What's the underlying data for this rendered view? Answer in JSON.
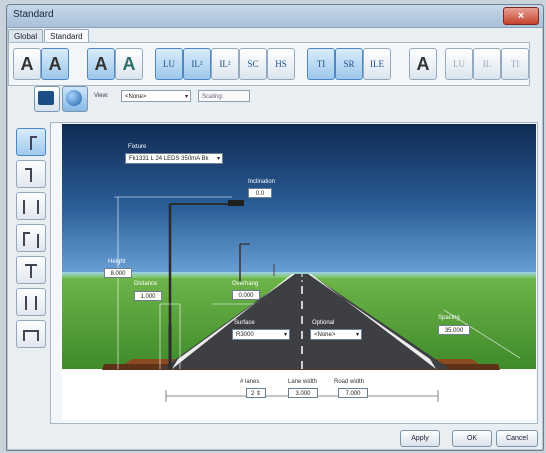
{
  "window": {
    "title": "Standard",
    "close_label": "×"
  },
  "tabs": [
    {
      "label": "Global"
    },
    {
      "label": "Standard"
    }
  ],
  "toolbar": [
    {
      "label": "A",
      "style": "bold"
    },
    {
      "label": "A",
      "style": "bold sel"
    },
    {
      "label": "A",
      "style": "bold sel"
    },
    {
      "label": "A",
      "style": "bold teal"
    },
    {
      "label": "LU",
      "style": "sel"
    },
    {
      "label": "IL²",
      "style": "sel"
    },
    {
      "label": "IL²",
      "style": ""
    },
    {
      "label": "SC",
      "style": ""
    },
    {
      "label": "HS",
      "style": ""
    },
    {
      "label": "TI",
      "style": "sel"
    },
    {
      "label": "SR",
      "style": "sel"
    },
    {
      "label": "ILE",
      "style": ""
    },
    {
      "label": "A",
      "style": "bold"
    },
    {
      "label": "LU",
      "style": "dim"
    },
    {
      "label": "IL",
      "style": "dim"
    },
    {
      "label": "TI",
      "style": "dim"
    }
  ],
  "row2": {
    "view_label": "View:",
    "view_value": "<None>",
    "scaling_label": "Scaling:"
  },
  "scene": {
    "fixture_label": "Fixture",
    "fixture_value": "Fk1331 L 24 LEDS 350mA Bk",
    "inclination_label": "Inclination",
    "inclination_value": "0.0",
    "height_label": "Height",
    "height_value": "8.000",
    "distance_label": "Distance",
    "distance_value": "1.000",
    "overhang_label": "Overhang",
    "overhang_value": "0.000",
    "surface_label": "Surface",
    "surface_value": "R3000",
    "optional_label": "Optional",
    "optional_value": "<None>",
    "spacing_label": "Spacing",
    "spacing_value": "35.000",
    "lanes_label": "# lanes",
    "lanes_value": "2",
    "lane_width_label": "Lane width",
    "lane_width_value": "3.000",
    "road_width_label": "Road width",
    "road_width_value": "7.000"
  },
  "footer": {
    "apply": "Apply",
    "ok": "OK",
    "cancel": "Cancel"
  },
  "colors": {
    "sky_top": "#0f2a52",
    "grass": "#4f9e36",
    "road": "#3d3f43"
  }
}
